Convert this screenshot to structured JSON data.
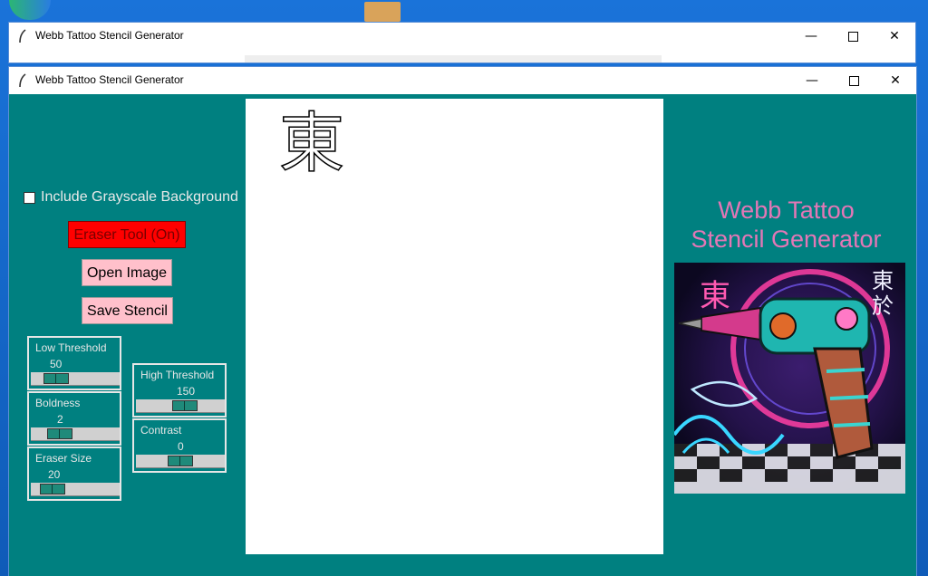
{
  "window_back": {
    "title": "Webb Tattoo Stencil Generator"
  },
  "window_front": {
    "title": "Webb Tattoo Stencil Generator"
  },
  "controls": {
    "grayscale_checkbox": {
      "label": "Include Grayscale Background",
      "checked": false
    },
    "eraser_button": "Eraser Tool (On)",
    "open_button": "Open Image",
    "save_button": "Save Stencil"
  },
  "sliders": {
    "low_threshold": {
      "label": "Low Threshold",
      "value": "50"
    },
    "boldness": {
      "label": "Boldness",
      "value": "2"
    },
    "eraser_size": {
      "label": "Eraser Size",
      "value": "20"
    },
    "high_threshold": {
      "label": "High Threshold",
      "value": "150"
    },
    "contrast": {
      "label": "Contrast",
      "value": "0"
    }
  },
  "canvas": {
    "stencil_glyph": "東"
  },
  "branding": {
    "title_line1": "Webb Tattoo",
    "title_line2": "Stencil Generator"
  },
  "poster_glyphs": {
    "left": "東",
    "right_top": "東",
    "right_bottom": "於"
  },
  "colors": {
    "app_bg": "#008080",
    "eraser_on": "#ff0000",
    "button_pink": "#ffc0cb",
    "title_pink": "#e377b6"
  }
}
